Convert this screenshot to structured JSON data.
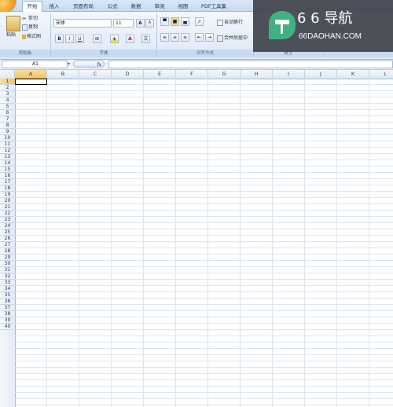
{
  "tabs": [
    "开始",
    "插入",
    "页面布局",
    "公式",
    "数据",
    "审阅",
    "视图",
    "PDF工具集"
  ],
  "active_tab": "开始",
  "clipboard": {
    "paste": "粘贴",
    "cut": "剪切",
    "copy": "复制",
    "format_painter": "格式刷",
    "group": "剪贴板"
  },
  "font": {
    "name": "宋体",
    "size": "11",
    "bold": "B",
    "italic": "I",
    "underline": "U",
    "grow": "A",
    "shrink": "A",
    "group": "字体"
  },
  "alignment": {
    "wrap_text": "自动换行",
    "merge_center": "合并后居中",
    "group": "对齐方式"
  },
  "number": {
    "group": "数字"
  },
  "formula_bar": {
    "name_box": "A1",
    "fx": "fx",
    "value": ""
  },
  "columns": [
    "A",
    "B",
    "C",
    "D",
    "E",
    "F",
    "G",
    "H",
    "I",
    "J",
    "K",
    "L"
  ],
  "rows": [
    "1",
    "2",
    "3",
    "4",
    "5",
    "6",
    "7",
    "8",
    "9",
    "10",
    "11",
    "12",
    "13",
    "14",
    "15",
    "16",
    "17",
    "18",
    "19",
    "20",
    "21",
    "22",
    "23",
    "24",
    "25",
    "26",
    "27",
    "28",
    "29",
    "30",
    "31",
    "32",
    "33",
    "34",
    "35",
    "36",
    "37",
    "38",
    "39",
    "40"
  ],
  "selected_cell": "A1",
  "watermark": {
    "digits": "6 6",
    "brand": "导航",
    "domain": "66DAOHAN.COM"
  },
  "colors": {
    "accent": "#2e6bbf",
    "watermark_green": "#3fb27f"
  }
}
